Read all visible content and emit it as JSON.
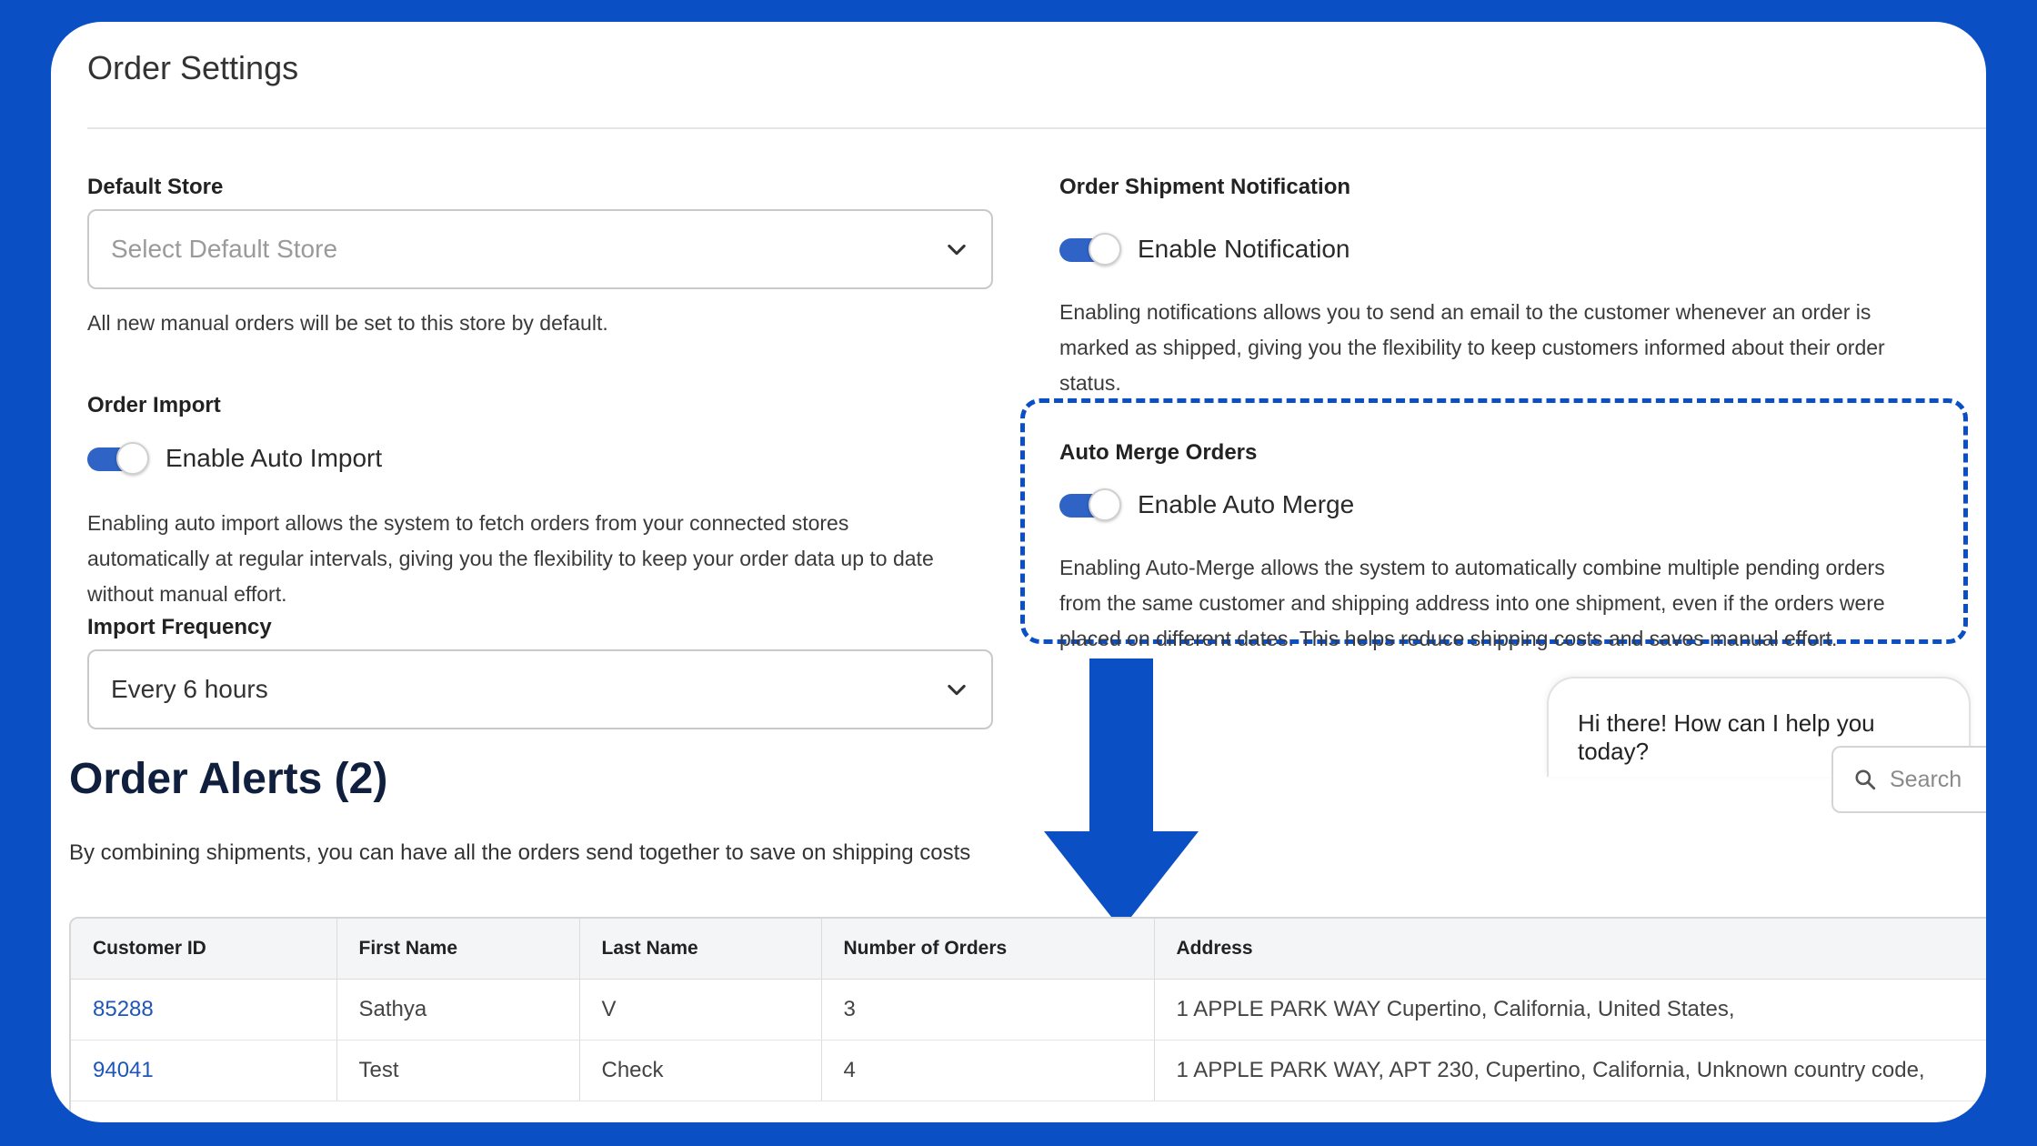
{
  "page": {
    "title": "Order Settings"
  },
  "default_store": {
    "label": "Default Store",
    "placeholder": "Select Default Store",
    "helper": "All new manual orders will be set to this store by default."
  },
  "order_import": {
    "label": "Order Import",
    "toggle_label": "Enable Auto Import",
    "toggle_on": true,
    "helper_lines": [
      "Enabling auto import allows the system to fetch orders from your connected stores",
      "automatically at regular intervals, giving you the flexibility to keep your order data up to date",
      "without manual effort."
    ]
  },
  "import_frequency": {
    "label": "Import Frequency",
    "value": "Every 6 hours"
  },
  "shipment_notification": {
    "label": "Order Shipment Notification",
    "toggle_label": "Enable Notification",
    "toggle_on": true,
    "helper_lines": [
      "Enabling notifications allows you to send an email to the customer whenever an order is",
      "marked as shipped, giving you the flexibility to keep customers informed about their order",
      "status."
    ]
  },
  "auto_merge": {
    "label": "Auto Merge Orders",
    "toggle_label": "Enable Auto Merge",
    "toggle_on": true,
    "helper_lines": [
      "Enabling Auto-Merge allows the system to automatically combine multiple pending orders",
      "from the same customer and shipping address into one shipment, even if the orders were",
      "placed on different dates. This helps reduce shipping costs and saves manual effort."
    ]
  },
  "chat": {
    "message": "Hi there! How can I help you today?"
  },
  "search": {
    "placeholder": "Search"
  },
  "alerts": {
    "title": "Order Alerts (2)",
    "subtitle": "By combining shipments, you can have all the orders send together to save on shipping costs",
    "columns": [
      "Customer ID",
      "First Name",
      "Last Name",
      "Number of Orders",
      "Address"
    ],
    "rows": [
      [
        "85288",
        "Sathya",
        "V",
        "3",
        "1 APPLE PARK WAY Cupertino, California, United States,"
      ],
      [
        "94041",
        "Test",
        "Check",
        "4",
        "1 APPLE PARK WAY, APT 230, Cupertino, California, Unknown country code,"
      ]
    ]
  },
  "colors": {
    "background": "#0a4fc4",
    "toggle_on": "#2f63c6",
    "link": "#1f56b8",
    "title_dark": "#0f1f3d"
  }
}
